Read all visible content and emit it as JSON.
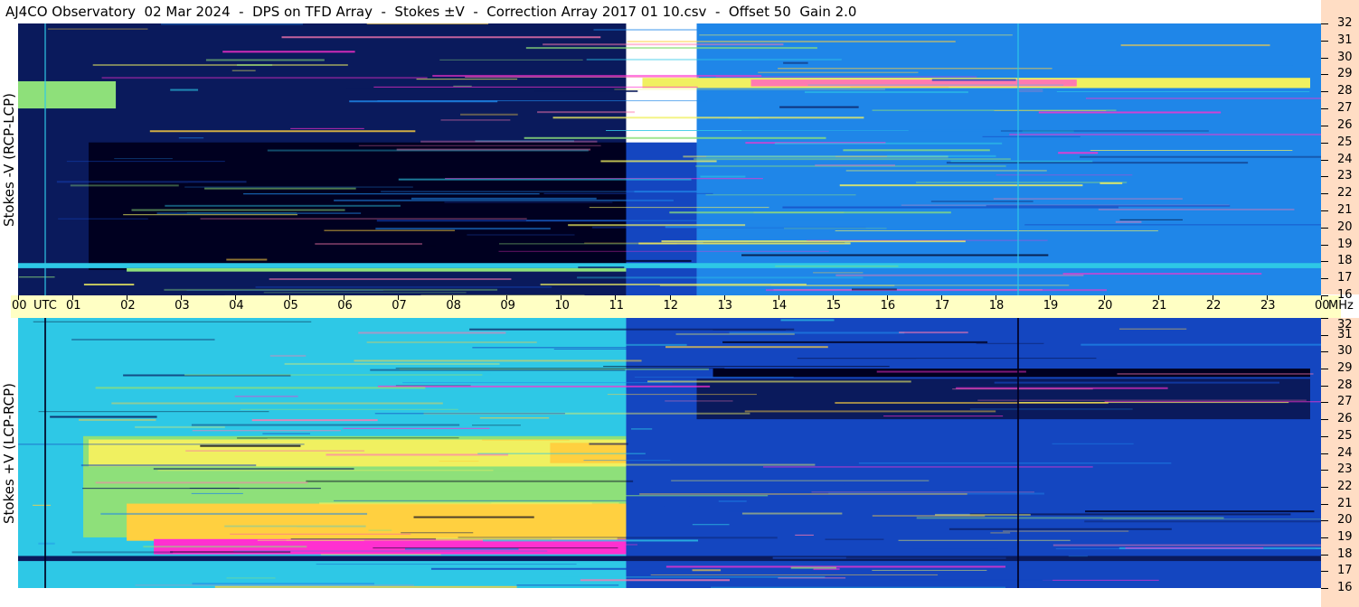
{
  "title": "AJ4CO Observatory  02 Mar 2024  -  DPS on TFD Array  -  Stokes ±V  -  Correction Array 2017 01 10.csv  -  Offset 50  Gain 2.0",
  "colors": {
    "axis_band": "#ffffc4",
    "right_scale": "#ffddc4",
    "palette": [
      "#000020",
      "#0a1a5c",
      "#1446c0",
      "#1f86e8",
      "#2ec8e6",
      "#8ee07a",
      "#f0f060",
      "#ffd040",
      "#ff7ab0",
      "#ff30d0"
    ]
  },
  "chart_data": [
    {
      "type": "heatmap",
      "panel": "top",
      "ylabel": "Stokes -V (RCP-LCP)",
      "x_ticks": [
        "00",
        "01",
        "02",
        "03",
        "04",
        "05",
        "06",
        "07",
        "08",
        "09",
        "10",
        "11",
        "12",
        "13",
        "14",
        "15",
        "16",
        "17",
        "18",
        "19",
        "20",
        "21",
        "22",
        "23",
        "00"
      ],
      "x_unit": "UTC",
      "xlim": [
        0,
        24
      ],
      "y_ticks": [
        "16",
        "17",
        "18",
        "19",
        "20",
        "21",
        "22",
        "23",
        "24",
        "25",
        "26",
        "27",
        "28",
        "29",
        "30",
        "31",
        "32"
      ],
      "ylim": [
        16,
        32
      ],
      "features": [
        {
          "t0": 0,
          "t1": 11.2,
          "f0": 16,
          "f1": 32,
          "level": 1
        },
        {
          "t0": 1.3,
          "t1": 11.2,
          "f0": 17.5,
          "f1": 25,
          "level": 0
        },
        {
          "t0": 11.2,
          "t1": 12.5,
          "f0": 16,
          "f1": 25,
          "level": 2
        },
        {
          "t0": 12.5,
          "t1": 24,
          "f0": 16,
          "f1": 32,
          "level": 3
        },
        {
          "t0": 11.5,
          "t1": 23.8,
          "f0": 28.2,
          "f1": 28.8,
          "level": 6
        },
        {
          "t0": 13.5,
          "t1": 19.5,
          "f0": 28.3,
          "f1": 28.7,
          "level": 8
        },
        {
          "t0": 0,
          "t1": 1.8,
          "f0": 27,
          "f1": 28.6,
          "level": 5
        },
        {
          "t0": 0,
          "t1": 24,
          "f0": 17.6,
          "f1": 17.9,
          "level": 4
        },
        {
          "t0": 2,
          "t1": 11.2,
          "f0": 17.4,
          "f1": 17.6,
          "level": 5
        }
      ]
    },
    {
      "type": "heatmap",
      "panel": "bottom",
      "ylabel": "Stokes +V (LCP-RCP)",
      "x_ticks": [
        "00",
        "01",
        "02",
        "03",
        "04",
        "05",
        "06",
        "07",
        "08",
        "09",
        "10",
        "11",
        "12",
        "13",
        "14",
        "15",
        "16",
        "17",
        "18",
        "19",
        "20",
        "21",
        "22",
        "23",
        "00"
      ],
      "x_unit": "MHz",
      "xlim": [
        0,
        24
      ],
      "y_ticks": [
        "16",
        "17",
        "18",
        "19",
        "20",
        "21",
        "22",
        "23",
        "24",
        "25",
        "26",
        "27",
        "28",
        "29",
        "30",
        "31",
        "32"
      ],
      "ylim": [
        16,
        32
      ],
      "features": [
        {
          "t0": 0,
          "t1": 11.2,
          "f0": 16,
          "f1": 32,
          "level": 4
        },
        {
          "t0": 1.2,
          "t1": 11.2,
          "f0": 19,
          "f1": 25,
          "level": 5
        },
        {
          "t0": 1.3,
          "t1": 11.2,
          "f0": 23.2,
          "f1": 24.8,
          "level": 6
        },
        {
          "t0": 9.8,
          "t1": 11.2,
          "f0": 23.4,
          "f1": 24.6,
          "level": 7
        },
        {
          "t0": 2,
          "t1": 11.2,
          "f0": 18.8,
          "f1": 21,
          "level": 7
        },
        {
          "t0": 2.5,
          "t1": 11.2,
          "f0": 18,
          "f1": 18.9,
          "level": 9
        },
        {
          "t0": 11.2,
          "t1": 24,
          "f0": 16,
          "f1": 32,
          "level": 2
        },
        {
          "t0": 12.8,
          "t1": 23.8,
          "f0": 28.5,
          "f1": 29,
          "level": 0
        },
        {
          "t0": 12.5,
          "t1": 23.8,
          "f0": 26,
          "f1": 28.4,
          "level": 1
        },
        {
          "t0": 0,
          "t1": 24,
          "f0": 17.6,
          "f1": 17.9,
          "level": 1
        }
      ]
    }
  ]
}
